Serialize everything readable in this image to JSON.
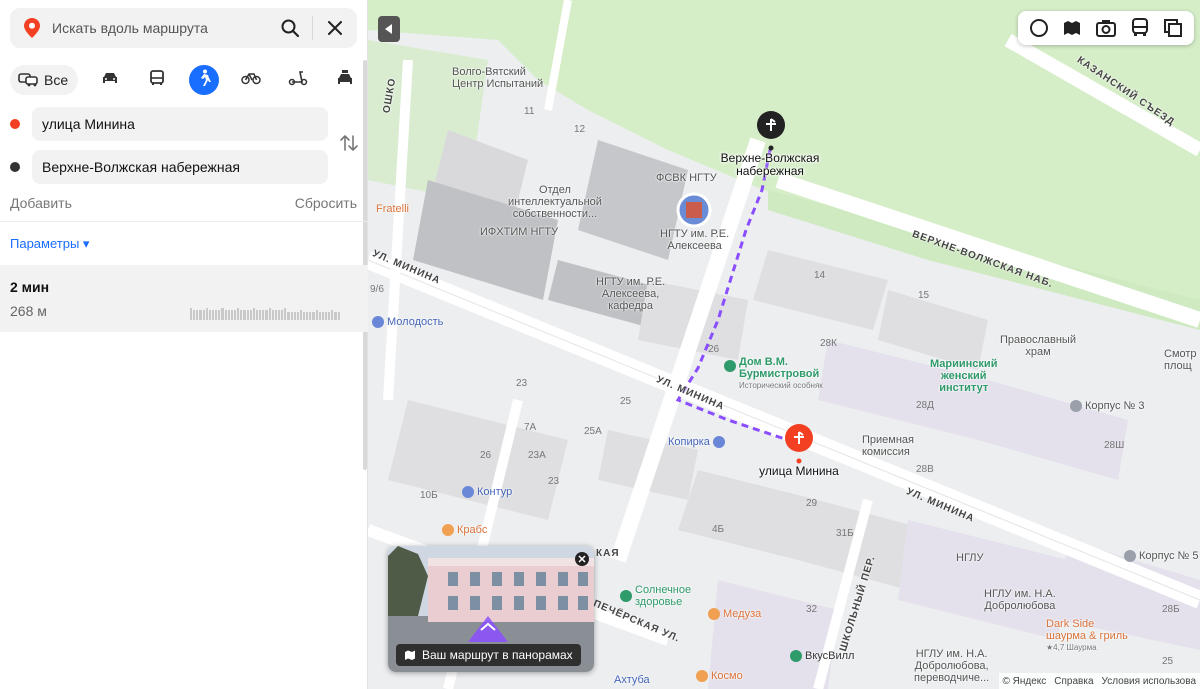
{
  "search": {
    "placeholder": "Искать вдоль маршрута"
  },
  "modes": {
    "all_label": "Все",
    "items": [
      "car-icon",
      "bus-icon",
      "walk-icon",
      "bike-icon",
      "scooter-icon",
      "taxi-icon"
    ],
    "active": "walk-icon"
  },
  "route": {
    "from": "улица Минина",
    "to": "Верхне-Волжская набережная",
    "add_label": "Добавить",
    "reset_label": "Сбросить",
    "params_label": "Параметры ▾",
    "time": "2 мин",
    "distance": "268 м"
  },
  "colors": {
    "accent": "#196dff",
    "route": "#8a4dff",
    "from_dot": "#f33f22",
    "to_dot": "#333333",
    "park": "#cdeec0",
    "road": "#ffffff"
  },
  "map": {
    "streets": {
      "minina_left": "УЛ. МИНИНА",
      "minina_mid": "УЛ. МИНИНА",
      "minina_right": "УЛ. МИНИНА",
      "embankment": "ВЕРХНЕ-ВОЛЖСКАЯ НАБ.",
      "kazansky": "КАЗАНСКИЙ СЪЕЗД",
      "shkolny": "ШКОЛЬНЫЙ ПЕР.",
      "pecherskaya": "ПЕЧЁРСКАЯ УЛ.",
      "oshko": "ОШКО",
      "kaya": "КАЯ"
    },
    "labels": {
      "center": "Волго-Вятский\nЦентр Испытаний",
      "ipo": "Отдел\nинтеллектуальной\nсобственности...",
      "ifhtim": "ИФХТИМ НГТУ",
      "fsvk": "ФСВК НГТУ",
      "ngtu_alexeev": "НГТУ им. Р.Е.\nАлексеева",
      "ngtu_kafedra": "НГТУ им. Р.Е.\nАлексеева,\nкафедра",
      "priemnaya": "Приемная\nкомиссия",
      "pravoslavny": "Православный\nхрам",
      "smotr": "Смотр\nплощ",
      "nglu": "НГЛУ",
      "dobrolubova": "НГЛУ им. Н.А.\nДобролюбова",
      "dobrolubova2": "НГЛУ им. Н.А.\nДобролюбова,\nпереводчиче...",
      "fratelli": "Fratelli"
    },
    "pois": {
      "molodost": "Молодость",
      "kontur": "Контур",
      "krabs": "Крабс",
      "kopirka": "Копирка",
      "dom": "Дом В.М.\nБурмистровой",
      "dom_sub": "Исторический особняк",
      "mariinsky": "Мариинский\nженский\nинститут",
      "korpus3": "Корпус № 3",
      "korpus5": "Корпус № 5",
      "solnechnoe": "Солнечное\nздоровье",
      "meduza": "Медуза",
      "darkside": "Dark Side\nшаурма & гриль",
      "darkside_sub": "★4,7 Шаурма",
      "vkusvill": "ВкусВилл",
      "akhtuba": "Ахтуба",
      "kosmo": "Космо"
    },
    "numbers": {
      "n11": "11",
      "n12": "12",
      "n14": "14",
      "n15": "15",
      "n26a": "26",
      "n28k": "28К",
      "n23": "23",
      "n25": "25",
      "n25a": "25А",
      "n7a": "7А",
      "n23a": "23А",
      "n26b": "26",
      "n23b": "23",
      "n10b": "10Б",
      "n28d": "28Д",
      "n28sh": "28Ш",
      "n28v": "28В",
      "n29": "29",
      "n31b": "31Б",
      "n4b": "4Б",
      "n32": "32",
      "n28b": "28Б",
      "n25c": "25",
      "n9_6": "9/6"
    },
    "route_from_label": "улица Минина",
    "route_to_label": "Верхне-Волжская\nнабережная"
  },
  "panorama": {
    "caption": "Ваш маршрут в панорамах"
  },
  "footer": {
    "yandex": "© Яндекс",
    "help": "Справка",
    "terms": "Условия использова"
  }
}
